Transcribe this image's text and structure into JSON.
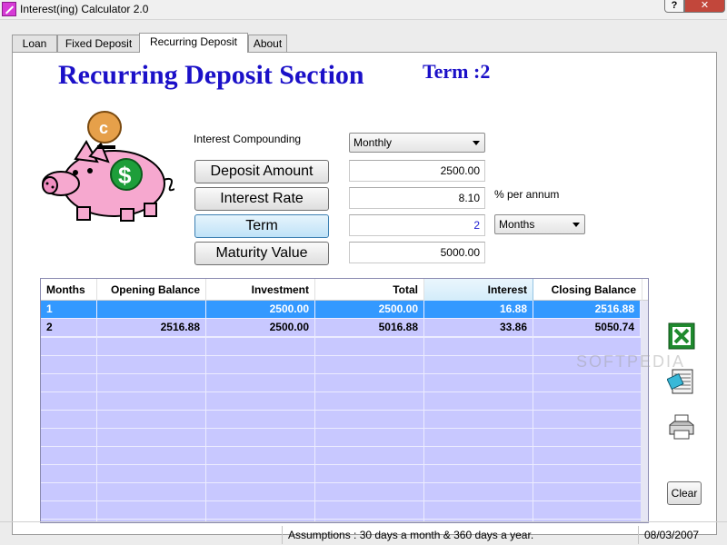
{
  "window": {
    "title": "Interest(ing) Calculator 2.0",
    "help_label": "?",
    "close_label": "✕"
  },
  "tabs": [
    "Loan",
    "Fixed Deposit",
    "Recurring Deposit",
    "About"
  ],
  "active_tab": "Recurring Deposit",
  "section": {
    "title": "Recurring Deposit Section",
    "term_label": "Term :2"
  },
  "form": {
    "compounding_label": "Interest Compounding",
    "compounding_value": "Monthly",
    "deposit_amount_label": "Deposit Amount",
    "deposit_amount_value": "2500.00",
    "interest_rate_label": "Interest Rate",
    "interest_rate_value": "8.10",
    "rate_unit": "% per annum",
    "term_label": "Term",
    "term_value": "2",
    "term_unit_value": "Months",
    "maturity_label": "Maturity Value",
    "maturity_value": "5000.00"
  },
  "table": {
    "columns": [
      "Months",
      "Opening Balance",
      "Investment",
      "Total",
      "Interest",
      "Closing Balance"
    ],
    "sorted_column": "Interest",
    "rows": [
      [
        "1",
        "",
        "2500.00",
        "2500.00",
        "16.88",
        "2516.88"
      ],
      [
        "2",
        "2516.88",
        "2500.00",
        "5016.88",
        "33.86",
        "5050.74"
      ]
    ],
    "selected_row": 0
  },
  "sidebar_icons": [
    "excel-export-icon",
    "notepad-icon",
    "printer-icon"
  ],
  "clear_label": "Clear",
  "watermark": "SOFTPEDIA",
  "status": {
    "assumptions": "Assumptions : 30 days a month & 360 days a year.",
    "date": "08/03/2007"
  },
  "colors": {
    "title_blue": "#1b10c8",
    "grid_bg": "#c8c8ff",
    "selection": "#3399ff",
    "piggy_pink": "#f6a8cf"
  }
}
